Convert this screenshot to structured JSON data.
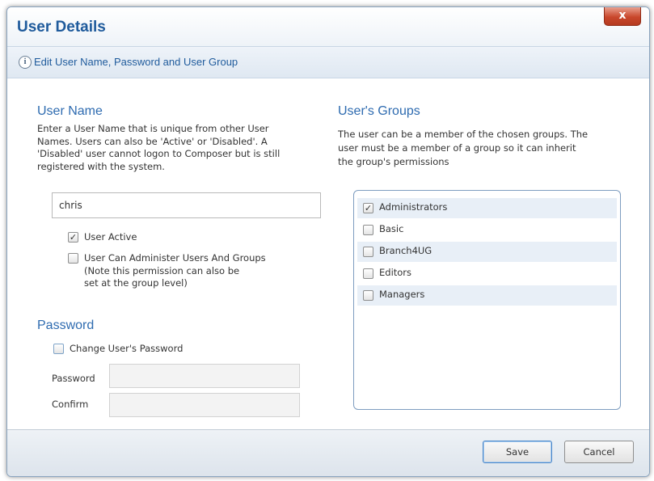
{
  "window": {
    "title": "User Details",
    "close_label": "x"
  },
  "info_bar": {
    "icon": "info-icon",
    "icon_glyph": "i",
    "text": "Edit User Name, Password and User Group"
  },
  "user_name": {
    "heading": "User Name",
    "description_lines": [
      "Enter a User Name that is unique from other User",
      "Names. Users can also be 'Active' or 'Disabled'. A",
      "'Disabled' user cannot logon to Composer but is still",
      "registered with the system."
    ],
    "value": "chris",
    "user_active": {
      "label": "User Active",
      "checked": true
    },
    "can_administer": {
      "label_lines": [
        "User Can Administer Users And Groups",
        "(Note this permission can also be",
        "set at the group level)"
      ],
      "checked": false
    }
  },
  "password": {
    "heading": "Password",
    "change_password": {
      "label": "Change User's Password",
      "checked": false
    },
    "password_label": "Password",
    "password_value": "",
    "confirm_label": "Confirm",
    "confirm_value": ""
  },
  "groups": {
    "heading": "User's Groups",
    "description_lines": [
      "The user can be a member of the chosen groups. The",
      "user must be a member of a group so it can inherit",
      "the group's permissions"
    ],
    "items": [
      {
        "label": "Administrators",
        "checked": true
      },
      {
        "label": "Basic",
        "checked": false
      },
      {
        "label": "Branch4UG",
        "checked": false
      },
      {
        "label": "Editors",
        "checked": false
      },
      {
        "label": "Managers",
        "checked": false
      }
    ]
  },
  "buttons": {
    "save_label": "Save",
    "cancel_label": "Cancel"
  },
  "colors": {
    "title": "#1f5b9c",
    "heading": "#2e6bb0",
    "close": "#c9472c",
    "list_border": "#7e9dc0"
  }
}
